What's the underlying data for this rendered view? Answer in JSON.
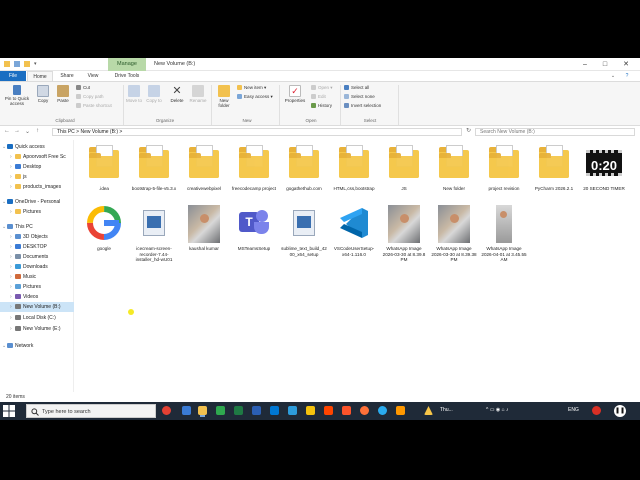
{
  "window": {
    "title": "New Volume (B:)",
    "manage_tab": "Manage",
    "tabs": [
      "File",
      "Home",
      "Share",
      "View",
      "Drive Tools"
    ]
  },
  "ribbon": {
    "pin": "Pin to Quick access",
    "copy": "Copy",
    "paste": "Paste",
    "cut": "Cut",
    "copy_path": "Copy path",
    "paste_shortcut": "Paste shortcut",
    "move_to": "Move to",
    "copy_to": "Copy to",
    "delete": "Delete",
    "rename": "Rename",
    "new_folder": "New folder",
    "new_item": "New item",
    "easy_access": "Easy access",
    "properties": "Properties",
    "open": "Open",
    "edit": "Edit",
    "history": "History",
    "select_all": "Select all",
    "select_none": "Select none",
    "invert_selection": "Invert selection",
    "groups": [
      "Clipboard",
      "Organize",
      "New",
      "Open",
      "Select"
    ]
  },
  "address": {
    "path": "This PC  >  New Volume (B:)  >",
    "search_placeholder": "Search New Volume (B:)"
  },
  "nav": {
    "items": [
      {
        "label": "Quick access",
        "level": 0
      },
      {
        "label": "Apoorvsoft Free Sc",
        "level": 1
      },
      {
        "label": "Desktop",
        "level": 1
      },
      {
        "label": "js",
        "level": 1
      },
      {
        "label": "products_images",
        "level": 1
      },
      {
        "label": "OneDrive - Personal",
        "level": 0
      },
      {
        "label": "Pictures",
        "level": 1
      },
      {
        "label": "This PC",
        "level": 0
      },
      {
        "label": "3D Objects",
        "level": 1
      },
      {
        "label": "DESKTOP",
        "level": 1
      },
      {
        "label": "Documents",
        "level": 1
      },
      {
        "label": "Downloads",
        "level": 1
      },
      {
        "label": "Music",
        "level": 1
      },
      {
        "label": "Pictures",
        "level": 1
      },
      {
        "label": "Videos",
        "level": 1
      },
      {
        "label": "New Volume (B:)",
        "level": 1
      },
      {
        "label": "Local Disk (C:)",
        "level": 1
      },
      {
        "label": "New Volume (E:)",
        "level": 1
      },
      {
        "label": "Network",
        "level": 0
      }
    ]
  },
  "files": [
    {
      "name": ".idea",
      "kind": "folder"
    },
    {
      "name": "bootstrap-5-file-v5.3.x",
      "kind": "folder"
    },
    {
      "name": "creativewebpixel",
      "kind": "folder"
    },
    {
      "name": "freecodecamp project",
      "kind": "folder"
    },
    {
      "name": "gogathethub.com",
      "kind": "folder"
    },
    {
      "name": "HTML,css,bootstrap",
      "kind": "folder"
    },
    {
      "name": "JS",
      "kind": "folder"
    },
    {
      "name": "New folder",
      "kind": "folder"
    },
    {
      "name": "project revision",
      "kind": "folder"
    },
    {
      "name": "PyCharm 2026.2.1",
      "kind": "folder"
    },
    {
      "name": "20 SECOND TIMER",
      "kind": "video"
    },
    {
      "name": "google",
      "kind": "google"
    },
    {
      "name": "icecream-screen-recorder-7.44-installer_hd-wU01",
      "kind": "installer"
    },
    {
      "name": "kaushal kumar",
      "kind": "photo"
    },
    {
      "name": "MSTeamsSetup",
      "kind": "teams"
    },
    {
      "name": "sublime_text_build_4200_x64_setup",
      "kind": "installer"
    },
    {
      "name": "VSCodeUserSetup-x64-1.116.0",
      "kind": "vscode"
    },
    {
      "name": "WhatsApp Image 2026-03-30 at 8.39.8 PM",
      "kind": "photo"
    },
    {
      "name": "WhatsApp Image 2026-03-30 at 8.39.38 PM",
      "kind": "photo"
    },
    {
      "name": "WhatsApp Image 2026-04-01 at 3.45.55 AM",
      "kind": "photo2"
    }
  ],
  "video_thumb_text": "0:20",
  "status": {
    "count": "20 items"
  },
  "taskbar": {
    "search_placeholder": "Type here to search",
    "weather_text": "Thu...",
    "lang": "ENG"
  }
}
